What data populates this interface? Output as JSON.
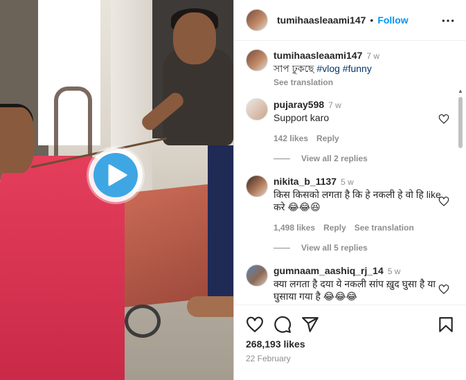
{
  "post": {
    "author": "tumihaasleaami147",
    "separator": "•",
    "follow_label": "Follow",
    "likes": "268,193 likes",
    "date": "22 February"
  },
  "caption": {
    "user": "tumihaasleaami147",
    "time": "7 w",
    "text": "সাপ ঢুকছে",
    "tags": [
      "#vlog",
      "#funny"
    ],
    "see_translation": "See translation"
  },
  "comments": [
    {
      "user": "pujaray598",
      "time": "7 w",
      "text": "Support karo",
      "likes": "142 likes",
      "reply": "Reply",
      "view_replies": "View all 2 replies"
    },
    {
      "user": "nikita_b_1137",
      "time": "5 w",
      "text": "किस किसको लगता है कि हे नकली हे वो हि like करे 😂😂😆",
      "likes": "1,498 likes",
      "reply": "Reply",
      "see_translation": "See translation",
      "view_replies": "View all 5 replies"
    },
    {
      "user": "gumnaam_aashiq_rj_14",
      "time": "5 w",
      "text": "क्या लगता है दया ये नकली सांप ख़ुद घुसा है या घुसाया गया है 😂😂😂"
    }
  ],
  "icons": {
    "play": "play-icon",
    "more": "more-options-icon",
    "like": "heart-icon",
    "comment": "comment-icon",
    "share": "share-icon",
    "save": "bookmark-icon"
  },
  "colors": {
    "follow": "#0095f6",
    "hashtag": "#00376b",
    "muted": "#8e8e8e",
    "play_accent": "#3fa6e4"
  }
}
